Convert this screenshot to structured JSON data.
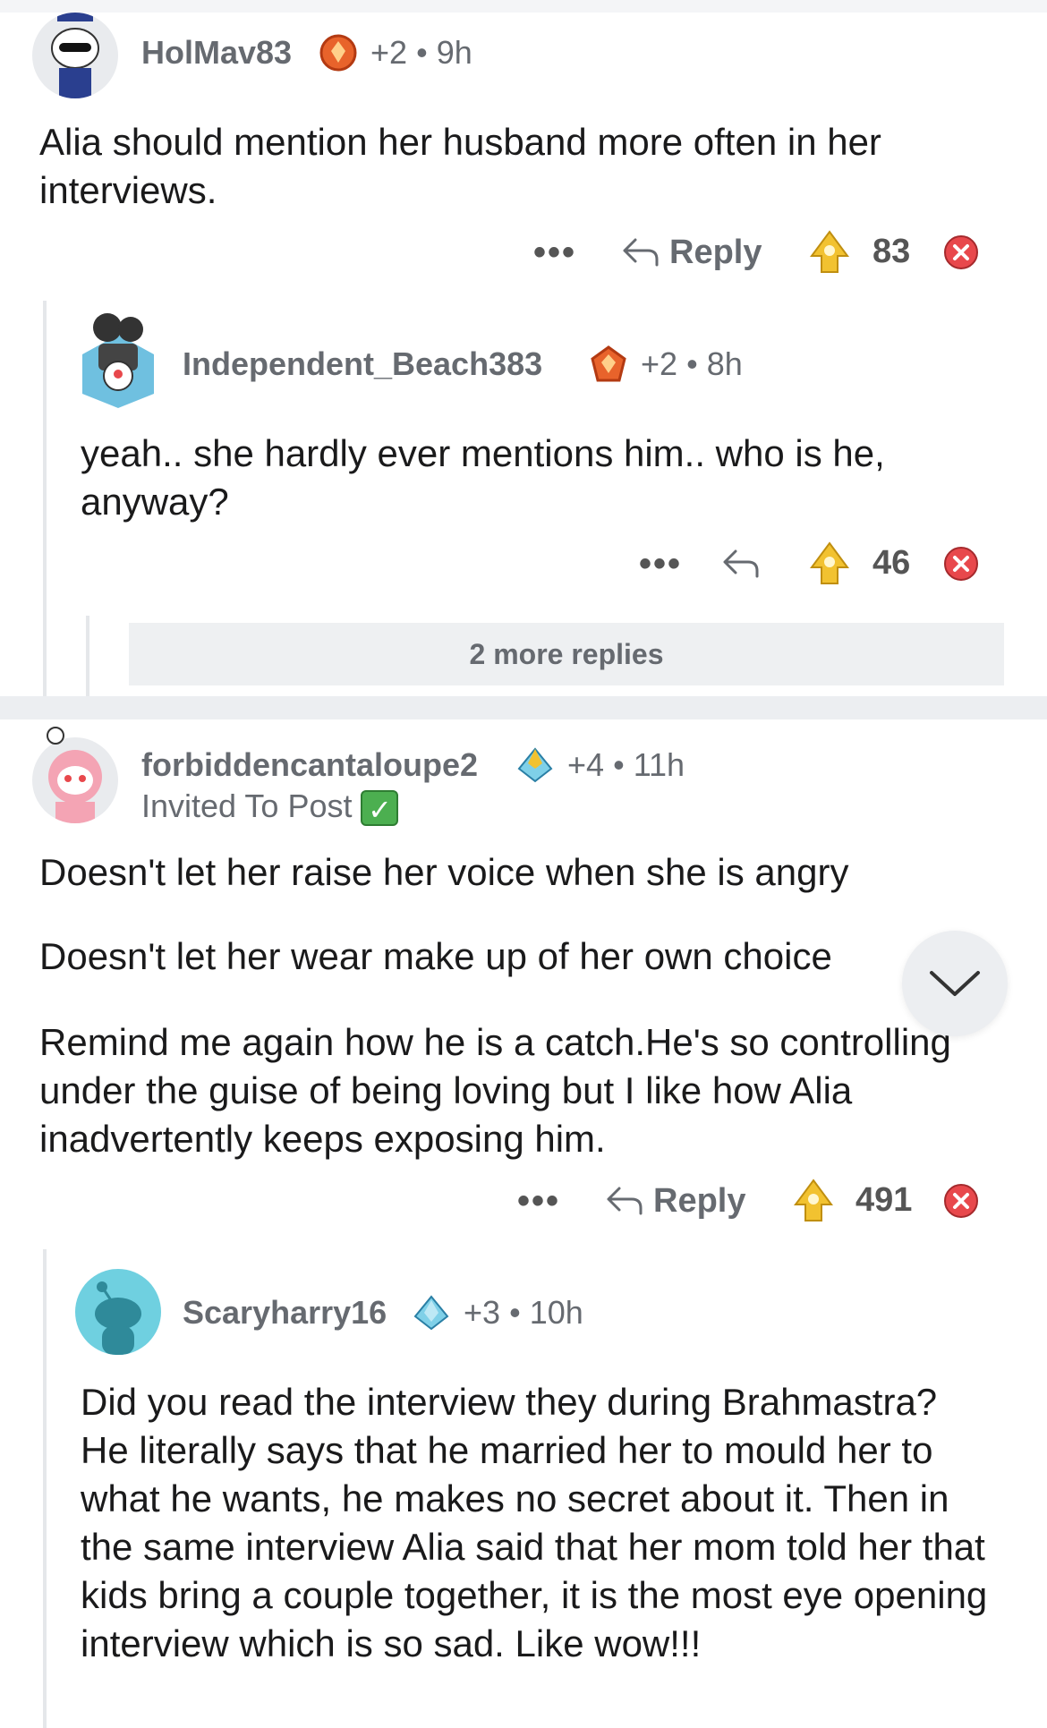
{
  "comments": [
    {
      "username": "HolMav83",
      "karma": "+2",
      "age": "9h",
      "text": "Alia should mention her husband more often in her interviews.",
      "reply_label": "Reply",
      "votes": "83",
      "more_icon": "ellipsis-icon",
      "badge_color": "#e8632b"
    },
    {
      "username": "Independent_Beach383",
      "karma": "+2",
      "age": "8h",
      "text": "yeah.. she hardly ever mentions him.. who is he, anyway?",
      "reply_label": "",
      "votes": "46",
      "more_replies": "2 more replies"
    },
    {
      "username": "forbiddencantaloupe2",
      "karma": "+4",
      "age": "11h",
      "flair": "Invited To Post",
      "paragraphs": [
        "Doesn't let her raise her voice when she is angry",
        "Doesn't let her wear make up of her own choice",
        "Remind me again how he is a catch.He's so controlling under the guise of being loving but  I like how Alia inadvertently keeps exposing him."
      ],
      "reply_label": "Reply",
      "votes": "491"
    },
    {
      "username": "Scaryharry16",
      "karma": "+3",
      "age": "10h",
      "text": "Did you read the interview they during Brahmastra? He literally says that he married her to mould her to what he wants, he makes no secret about it. Then in the same interview Alia said that her mom told her that kids bring a couple together, it is the most eye opening interview which is so sad. Like wow!!!"
    }
  ],
  "separator": "•",
  "colors": {
    "upvote": "#f2c230",
    "downvote": "#e8484c",
    "accent_green": "#4caf50"
  }
}
